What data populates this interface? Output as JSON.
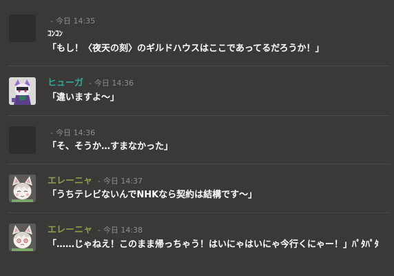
{
  "messages": [
    {
      "author": "",
      "timestamp_prefix": "-",
      "timestamp": "今日 14:35",
      "pre_text": "ｺﾝｺﾝ",
      "text": "「もし！〈夜天の刻〉のギルドハウスはここであってるだろうか！」",
      "avatar": "blank"
    },
    {
      "author": "ヒューガ",
      "author_color": "#2ea99a",
      "timestamp_prefix": "-",
      "timestamp": "今日 14:36",
      "text": "「違いますよ〜」",
      "avatar": "hooded-cat-character"
    },
    {
      "author": "",
      "timestamp_prefix": "-",
      "timestamp": "今日 14:36",
      "text": "「そ、そうか…すまなかった」",
      "avatar": "blank"
    },
    {
      "author": "エレーニャ",
      "author_color": "#8aa04a",
      "timestamp_prefix": "-",
      "timestamp": "今日 14:37",
      "text": "「うちテレビないんでNHKなら契約は結構です〜」",
      "avatar": "catgirl-character"
    },
    {
      "author": "エレーニャ",
      "author_color": "#8aa04a",
      "timestamp_prefix": "-",
      "timestamp": "今日 14:38",
      "text": "「……じゃねえ！このまま帰っちゃう！はいにゃはいにゃ今行くにゃー！」ﾊﾟﾀﾊﾟﾀ",
      "avatar": "catgirl-character"
    }
  ]
}
